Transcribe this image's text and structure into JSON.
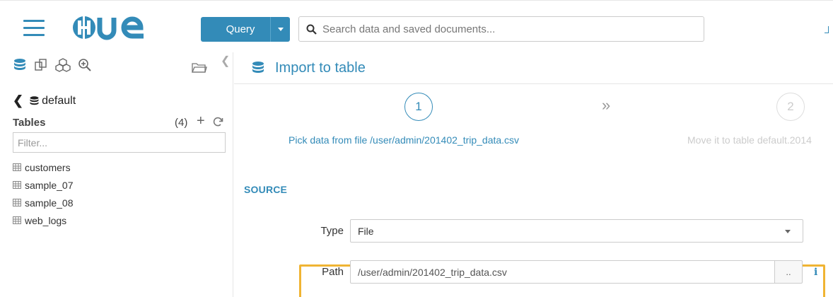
{
  "header": {
    "query_button": {
      "label": "Query"
    },
    "search": {
      "placeholder": "Search data and saved documents..."
    }
  },
  "left_panel": {
    "database": "default",
    "tables_title": "Tables",
    "tables_count": "(4)",
    "filter_placeholder": "Filter...",
    "tables": [
      {
        "name": "customers"
      },
      {
        "name": "sample_07"
      },
      {
        "name": "sample_08"
      },
      {
        "name": "web_logs"
      }
    ],
    "icons": [
      "database-icon",
      "copy-icon",
      "cubes-icon",
      "zoom-in-icon",
      "folder-open-icon"
    ]
  },
  "main": {
    "title": "Import to table",
    "steps": [
      {
        "number": "1",
        "label": "Pick data from file /user/admin/201402_trip_data.csv",
        "state": "active"
      },
      {
        "number": "2",
        "label": "Move it to table default.2014",
        "state": "inactive"
      }
    ],
    "step_separator": "»",
    "section_title": "SOURCE",
    "form": {
      "type_label": "Type",
      "type_value": "File",
      "path_label": "Path",
      "path_value": "/user/admin/201402_trip_data.csv",
      "browse_label": "..",
      "info_glyph": "i"
    }
  },
  "colors": {
    "accent": "#338bb8",
    "highlight": "#f0b433"
  }
}
